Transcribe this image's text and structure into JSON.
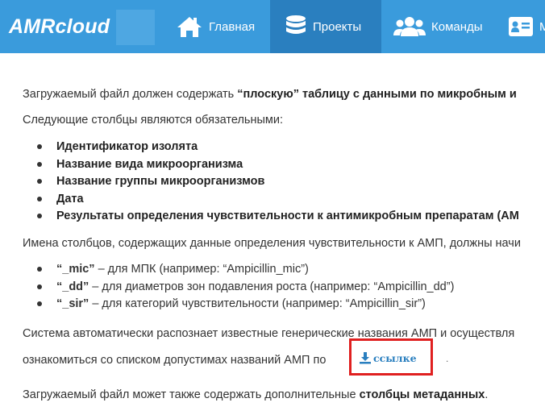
{
  "brand": "AMRcloud",
  "nav": {
    "home": "Главная",
    "projects": "Проекты",
    "teams": "Команды",
    "more": "М"
  },
  "content": {
    "para_file_prefix": "Загружаемый файл должен содержать ",
    "para_file_bold": "“плоскую” таблицу с данными по микробным и",
    "para_required": "Следующие столбцы являются обязательными:",
    "required_columns": [
      "Идентификатор изолята",
      "Название вида микроорганизма",
      "Название группы микроорганизмов",
      "Дата",
      "Результаты определения чувствительности к антимикробным препаратам (АМ"
    ],
    "para_names": "Имена столбцов, содержащих данные определения чувствительности к АМП, должны начи",
    "suffixes": [
      {
        "code": "“_mic”",
        "text": " – для МПК (например: “Ampicillin_mic”)"
      },
      {
        "code": "“_dd”",
        "text": " – для диаметров зон подавления роста (например: “Ampicillin_dd”)"
      },
      {
        "code": "“_sir”",
        "text": " – для категорий чувствительности (например: “Ampicillin_sir”)"
      }
    ],
    "para_auto": "Система автоматически распознает известные генерические названия АМП и осуществля",
    "para_link_prefix": "ознакомиться со списком допустимах названий АМП по",
    "link_label": "ссылке",
    "link_suffix": ".",
    "para_meta_prefix": "Загружаемый файл может также содержать дополнительные ",
    "para_meta_bold": "столбцы метаданных",
    "para_meta_suffix": "."
  }
}
